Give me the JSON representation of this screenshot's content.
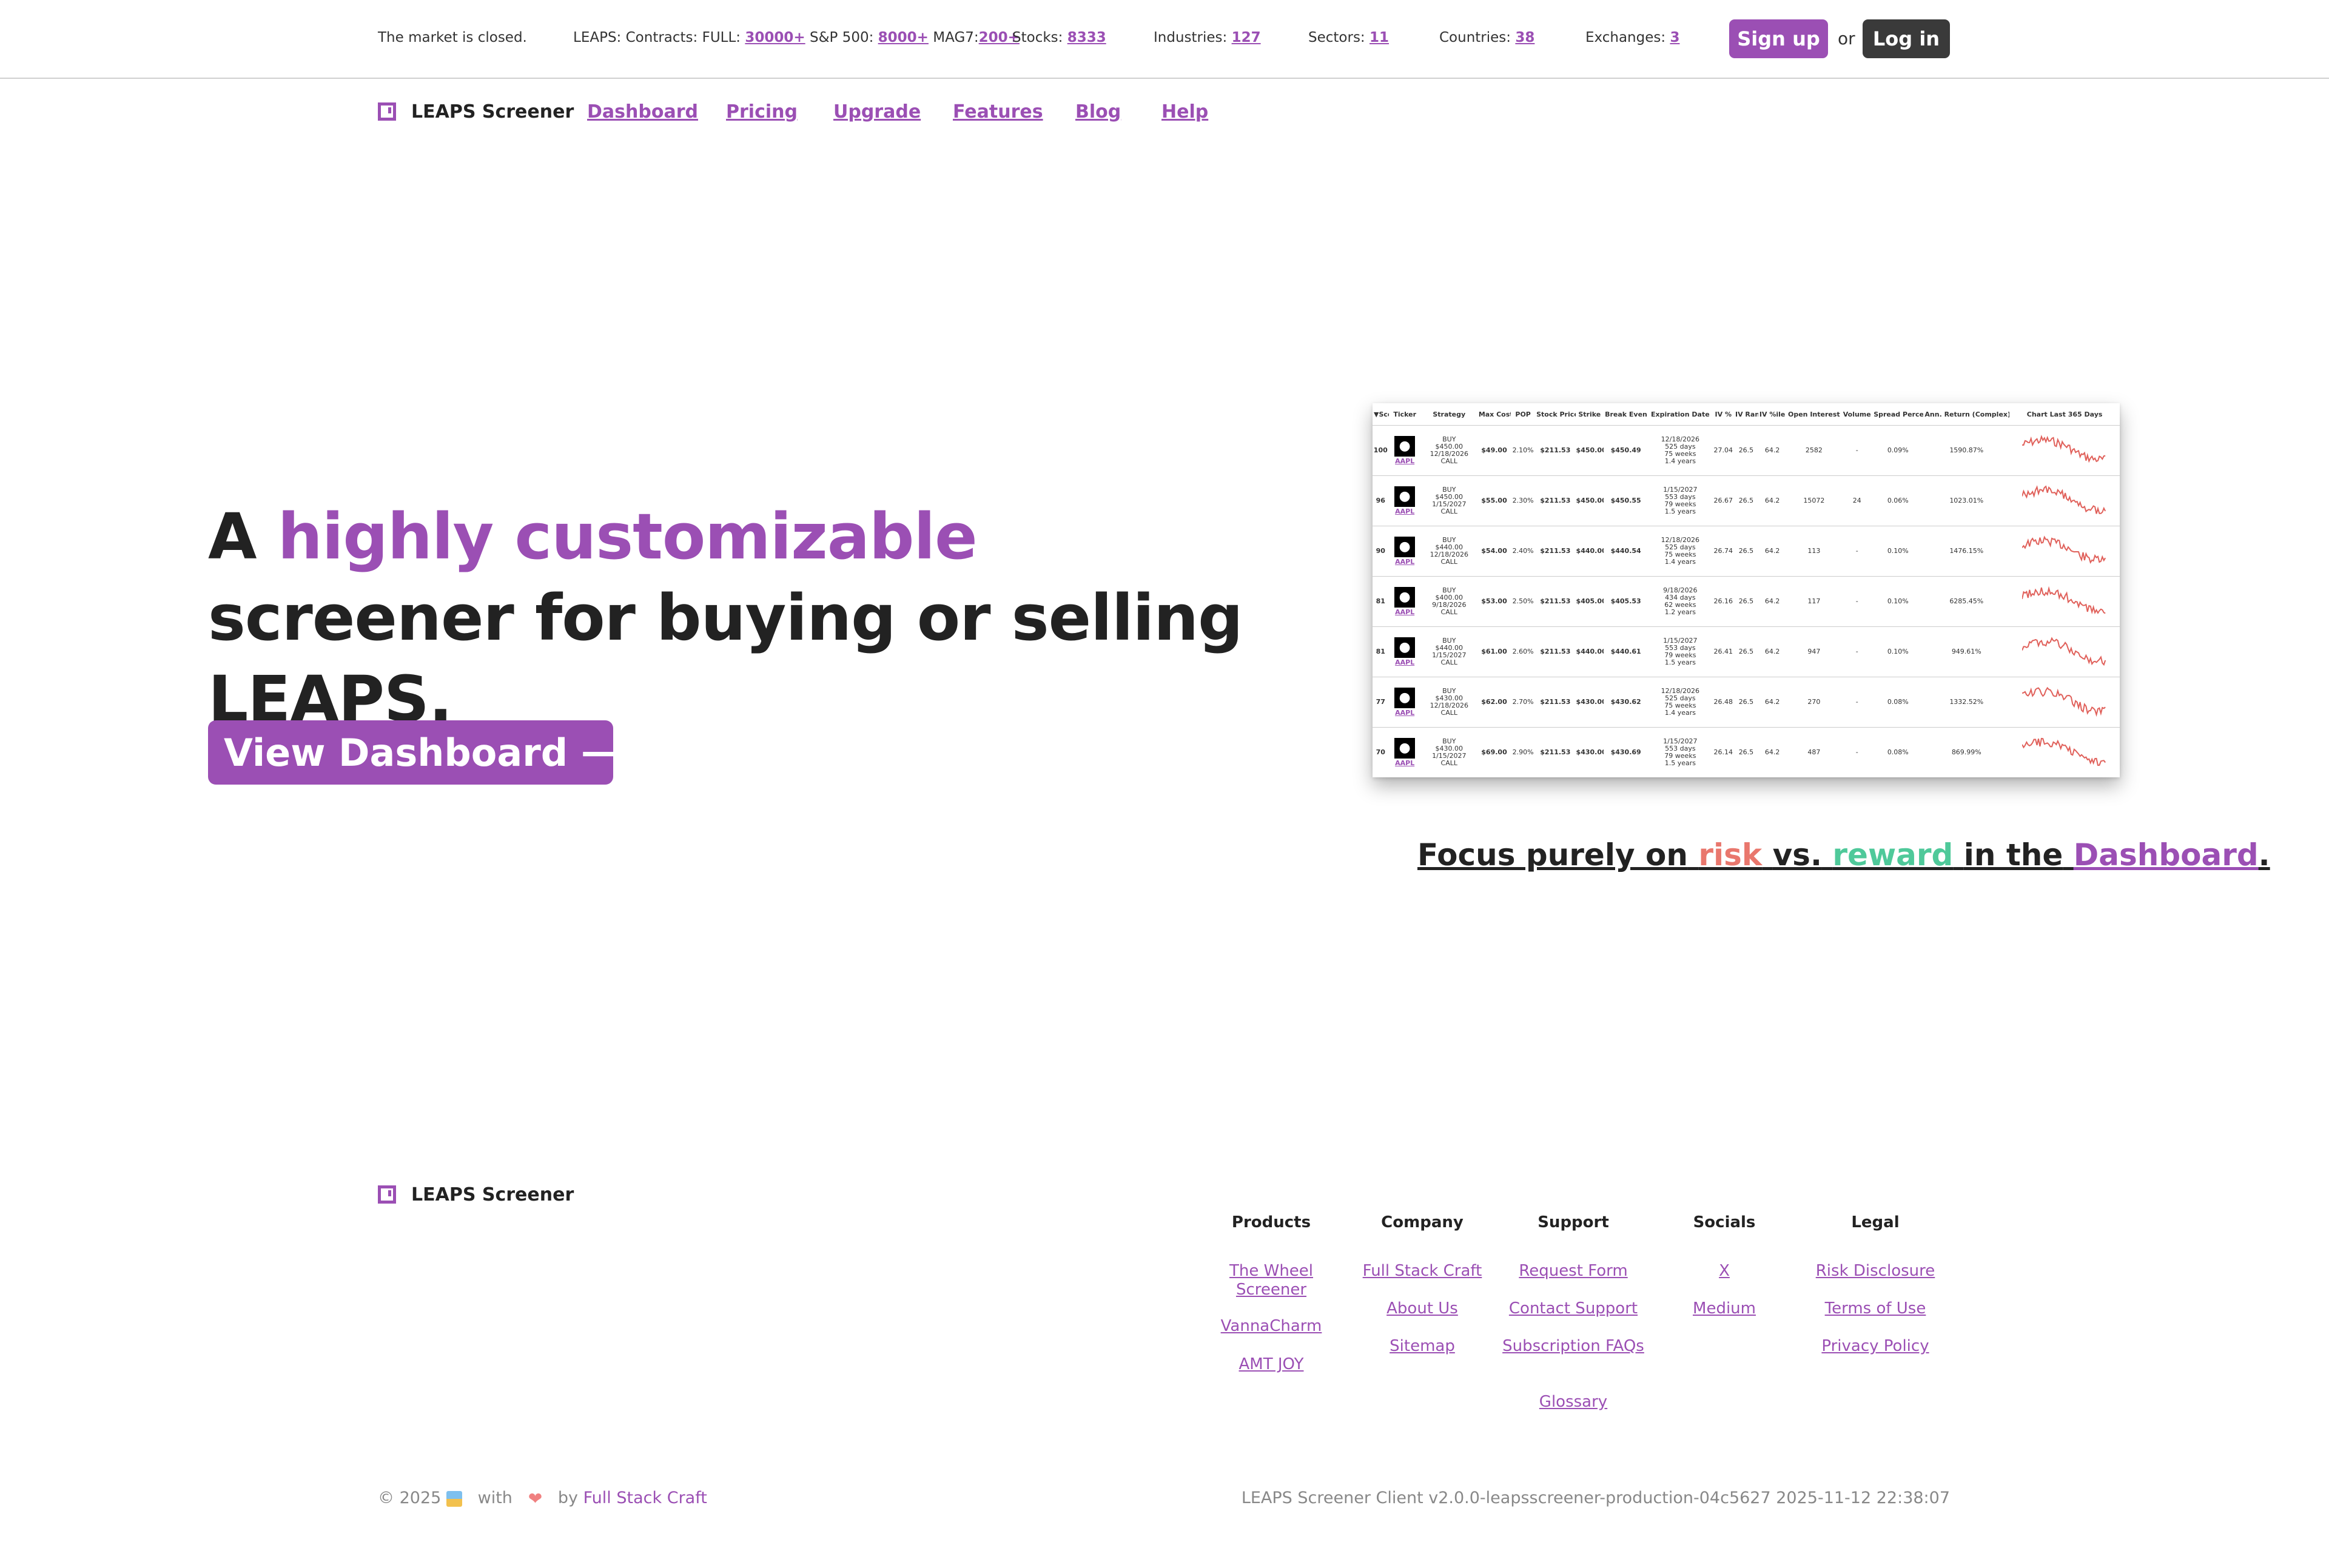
{
  "topbar": {
    "market_status": "The market is closed.",
    "leaps_label": "LEAPS: Contracts: FULL:",
    "full_count": "30000+",
    "sp500_label": "S&P 500:",
    "sp500_count": "8000+",
    "mag7_label": "MAG7:",
    "mag7_count": "200+",
    "stocks_label": "Stocks:",
    "stocks_count": "8333",
    "industries_label": "Industries:",
    "industries_count": "127",
    "sectors_label": "Sectors:",
    "sectors_count": "11",
    "countries_label": "Countries:",
    "countries_count": "38",
    "exchanges_label": "Exchanges:",
    "exchanges_count": "3",
    "signup_label": "Sign up",
    "or_label": "or",
    "login_label": "Log in"
  },
  "nav": {
    "logo_text": "LEAPS Screener",
    "items": [
      "Dashboard",
      "Pricing",
      "Upgrade",
      "Features",
      "Blog",
      "Help"
    ]
  },
  "hero": {
    "title_pre": "A",
    "title_highlight": "highly customizable",
    "title_post": "screener for buying or selling LEAPS.",
    "cta_label": "View Dashboard ⟶"
  },
  "preview": {
    "headers": [
      "▼Score",
      "Ticker",
      "Strategy",
      "Max Cost",
      "POP",
      "Stock Price",
      "Strike",
      "Break Even",
      "Expiration Date",
      "IV %",
      "IV Rank",
      "IV %ile",
      "Open Interest",
      "Volume",
      "Spread Percent",
      "Ann. Return (Complex)",
      "Chart Last 365 Days"
    ],
    "rows": [
      {
        "score": "100",
        "ticker": "AAPL",
        "strategy": [
          "BUY",
          "$450.00 12/18/2026",
          "CALL"
        ],
        "max_cost": "$49.00",
        "pop": "2.10%",
        "stock_price": "$211.53",
        "strike": "$450.00",
        "break_even": "$450.49",
        "expiration": [
          "12/18/2026",
          "525 days",
          "75 weeks",
          "1.4 years"
        ],
        "iv": "27.04",
        "iv_rank": "26.5",
        "iv_pctile": "64.2",
        "open_interest": "2582",
        "volume": "-",
        "spread": "0.09%",
        "ann_return": "1590.87%"
      },
      {
        "score": "96",
        "ticker": "AAPL",
        "strategy": [
          "BUY",
          "$450.00 1/15/2027",
          "CALL"
        ],
        "max_cost": "$55.00",
        "pop": "2.30%",
        "stock_price": "$211.53",
        "strike": "$450.00",
        "break_even": "$450.55",
        "expiration": [
          "1/15/2027",
          "553 days",
          "79 weeks",
          "1.5 years"
        ],
        "iv": "26.67",
        "iv_rank": "26.5",
        "iv_pctile": "64.2",
        "open_interest": "15072",
        "volume": "24",
        "spread": "0.06%",
        "ann_return": "1023.01%"
      },
      {
        "score": "90",
        "ticker": "AAPL",
        "strategy": [
          "BUY",
          "$440.00 12/18/2026",
          "CALL"
        ],
        "max_cost": "$54.00",
        "pop": "2.40%",
        "stock_price": "$211.53",
        "strike": "$440.00",
        "break_even": "$440.54",
        "expiration": [
          "12/18/2026",
          "525 days",
          "75 weeks",
          "1.4 years"
        ],
        "iv": "26.74",
        "iv_rank": "26.5",
        "iv_pctile": "64.2",
        "open_interest": "113",
        "volume": "-",
        "spread": "0.10%",
        "ann_return": "1476.15%"
      },
      {
        "score": "81",
        "ticker": "AAPL",
        "strategy": [
          "BUY",
          "$400.00 9/18/2026",
          "CALL"
        ],
        "max_cost": "$53.00",
        "pop": "2.50%",
        "stock_price": "$211.53",
        "strike": "$405.00",
        "break_even": "$405.53",
        "expiration": [
          "9/18/2026",
          "434 days",
          "62 weeks",
          "1.2 years"
        ],
        "iv": "26.16",
        "iv_rank": "26.5",
        "iv_pctile": "64.2",
        "open_interest": "117",
        "volume": "-",
        "spread": "0.10%",
        "ann_return": "6285.45%"
      },
      {
        "score": "81",
        "ticker": "AAPL",
        "strategy": [
          "BUY",
          "$440.00 1/15/2027",
          "CALL"
        ],
        "max_cost": "$61.00",
        "pop": "2.60%",
        "stock_price": "$211.53",
        "strike": "$440.00",
        "break_even": "$440.61",
        "expiration": [
          "1/15/2027",
          "553 days",
          "79 weeks",
          "1.5 years"
        ],
        "iv": "26.41",
        "iv_rank": "26.5",
        "iv_pctile": "64.2",
        "open_interest": "947",
        "volume": "-",
        "spread": "0.10%",
        "ann_return": "949.61%"
      },
      {
        "score": "77",
        "ticker": "AAPL",
        "strategy": [
          "BUY",
          "$430.00 12/18/2026",
          "CALL"
        ],
        "max_cost": "$62.00",
        "pop": "2.70%",
        "stock_price": "$211.53",
        "strike": "$430.00",
        "break_even": "$430.62",
        "expiration": [
          "12/18/2026",
          "525 days",
          "75 weeks",
          "1.4 years"
        ],
        "iv": "26.48",
        "iv_rank": "26.5",
        "iv_pctile": "64.2",
        "open_interest": "270",
        "volume": "-",
        "spread": "0.08%",
        "ann_return": "1332.52%"
      },
      {
        "score": "70",
        "ticker": "AAPL",
        "strategy": [
          "BUY",
          "$430.00 1/15/2027",
          "CALL"
        ],
        "max_cost": "$69.00",
        "pop": "2.90%",
        "stock_price": "$211.53",
        "strike": "$430.00",
        "break_even": "$430.69",
        "expiration": [
          "1/15/2027",
          "553 days",
          "79 weeks",
          "1.5 years"
        ],
        "iv": "26.14",
        "iv_rank": "26.5",
        "iv_pctile": "64.2",
        "open_interest": "487",
        "volume": "-",
        "spread": "0.08%",
        "ann_return": "869.99%"
      }
    ]
  },
  "caption": {
    "pre": "Focus purely on",
    "risk": "risk",
    "mid": "vs.",
    "reward": "reward",
    "post": "in the",
    "dashboard": "Dashboard",
    "end": "."
  },
  "footer": {
    "logo_text": "LEAPS Screener",
    "columns": [
      {
        "title": "Products",
        "links": [
          "The Wheel Screener",
          "VannaCharm",
          "AMT JOY"
        ]
      },
      {
        "title": "Company",
        "links": [
          "Full Stack Craft",
          "About Us",
          "Sitemap"
        ]
      },
      {
        "title": "Support",
        "links": [
          "Request Form",
          "Contact Support",
          "Subscription FAQs",
          "Glossary"
        ]
      },
      {
        "title": "Socials",
        "links": [
          "X",
          "Medium"
        ]
      },
      {
        "title": "Legal",
        "links": [
          "Risk Disclosure",
          "Terms of Use",
          "Privacy Policy"
        ]
      }
    ],
    "copyright_pre": "© 2025",
    "copyright_with": "with",
    "copyright_by": "by",
    "copyright_company": "Full Stack Craft",
    "version": "LEAPS Screener Client v2.0.0-leapsscreener-production-04c5627 2025-11-12 22:38:07"
  },
  "colors": {
    "accent": "#9b4fb4",
    "risk": "#e9776d",
    "reward": "#4fc99a",
    "dark_button": "#3a3a3a"
  }
}
